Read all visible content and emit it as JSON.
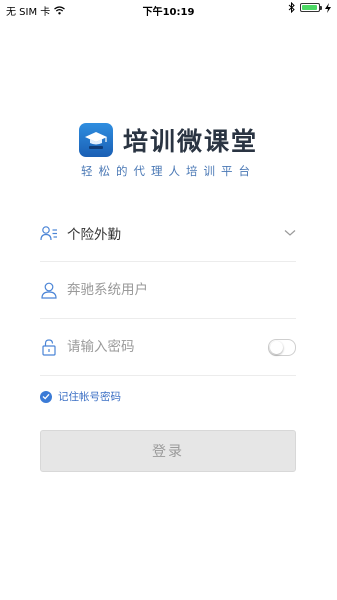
{
  "status_bar": {
    "carrier": "无 SIM 卡",
    "time": "下午10:19"
  },
  "app": {
    "title": "培训微课堂",
    "slogan": "轻松的代理人培训平台"
  },
  "form": {
    "role_select": {
      "value": "个险外勤"
    },
    "username": {
      "placeholder": "奔驰系统用户"
    },
    "password": {
      "placeholder": "请输入密码"
    },
    "remember_label": "记住帐号密码",
    "login_label": "登录"
  },
  "colors": {
    "accent": "#3b7bd6",
    "title": "#2a3442",
    "slogan": "#4a78b5",
    "button_disabled": "#e6e6e6"
  }
}
